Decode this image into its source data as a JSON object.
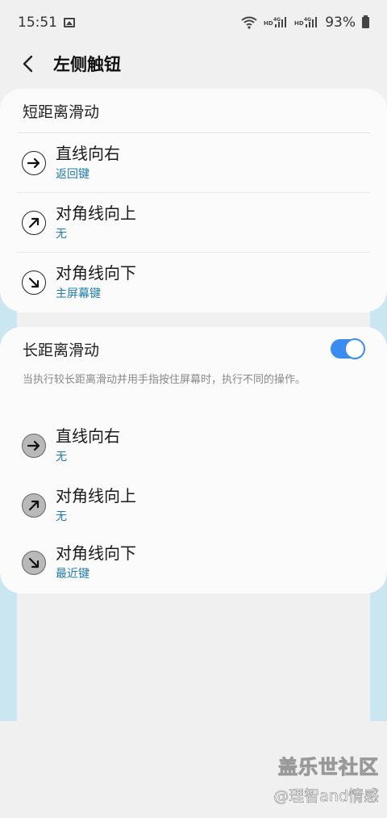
{
  "status_bar": {
    "time": "15:51",
    "battery": "93%",
    "icons": [
      "image-icon",
      "wifi-icon",
      "hd-4g-signal-icon",
      "hd-4g-signal-icon",
      "battery-icon"
    ]
  },
  "header": {
    "title": "左侧触钮",
    "back_icon": "chevron-left-icon"
  },
  "short_swipe": {
    "title": "短距离滑动",
    "items": [
      {
        "label": "直线向右",
        "value": "返回键",
        "icon": "arrow-right-icon"
      },
      {
        "label": "对角线向上",
        "value": "无",
        "icon": "arrow-up-right-icon"
      },
      {
        "label": "对角线向下",
        "value": "主屏幕键",
        "icon": "arrow-down-right-icon"
      }
    ]
  },
  "long_swipe": {
    "title": "长距离滑动",
    "enabled": true,
    "description": "当执行较长距离滑动并用手指按住屏幕时，执行不同的操作。",
    "items": [
      {
        "label": "直线向右",
        "value": "无",
        "icon": "arrow-right-icon"
      },
      {
        "label": "对角线向上",
        "value": "无",
        "icon": "arrow-up-right-icon"
      },
      {
        "label": "对角线向下",
        "value": "最近键",
        "icon": "arrow-down-right-icon"
      }
    ]
  },
  "watermark": {
    "brand": "盖乐世社区",
    "user": "@理智and情感"
  },
  "colors": {
    "accent": "#3b8cf0",
    "link": "#1d7cb0",
    "background": "#f0f0f0",
    "side_strip": "#c9e6f1"
  }
}
